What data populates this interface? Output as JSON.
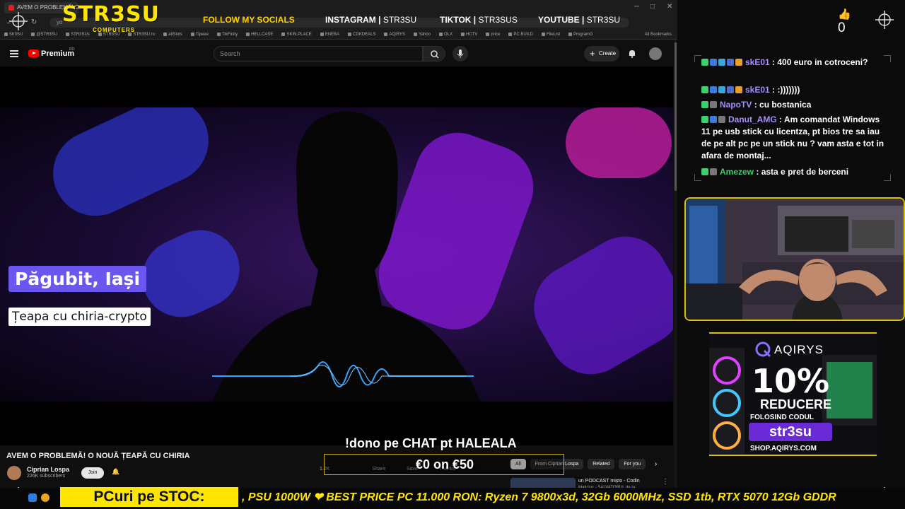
{
  "browser": {
    "tab_title": "AVEM O PROBLEMĂ! O N...",
    "url_text": "yo",
    "bookmarks": [
      "Str3SU",
      "@STR3SU",
      "STR3SUs",
      "STR3SU",
      "STR3SU.ro",
      "altSlots",
      "Tipeee",
      "TikFinity",
      "HELLCASE",
      "SKIN.PLACE",
      "ENEBA",
      "CDKDEALS",
      "AQIRYS",
      "Yahoo",
      "OLX",
      "HCTV",
      "price",
      "PC BUILD",
      "FileList",
      "ProgramG"
    ],
    "all_bookmarks": "All Bookmarks"
  },
  "brand": {
    "logo": "STR3SU",
    "logo_sub": "COMPUTERS",
    "follow": "FOLLOW MY SOCIALS",
    "socials": [
      {
        "platform": "INSTAGRAM",
        "handle": "STR3SU"
      },
      {
        "platform": "TIKTOK",
        "handle": "STR3SUS"
      },
      {
        "platform": "YOUTUBE",
        "handle": "STR3SU"
      }
    ]
  },
  "youtube": {
    "brand": "Premium",
    "region": "RO",
    "search_placeholder": "Search",
    "create_label": "Create"
  },
  "video": {
    "headline": "Păgubit, Iași",
    "subheadline": "Țeapa cu chiria-crypto",
    "title": "AVEM O PROBLEMĂ! O NOUĂ ȚEAPĂ CU CHIRIA",
    "channel": "Ciprian Lospa",
    "subscribers": "226K subscribers",
    "join_label": "Join",
    "actions": [
      "1.2K",
      "",
      "Share",
      "Save",
      "Thanks"
    ]
  },
  "filter_chips": [
    "All",
    "From Ciprian Lospa",
    "Related",
    "For you"
  ],
  "recommendation": {
    "title": "un PODCAST mișto - Codin",
    "channel": "Maticiuc - SALVATORUL de la..."
  },
  "overlay": {
    "dono_command": "!dono pe CHAT pt HALEALA",
    "goal": "€0 on €50",
    "stoc_label": "PCuri pe STOC:",
    "ticker": ", PSU 1000W  ❤ BEST PRICE PC 11.000 RON: Ryzen 7 9800x3d, 32Gb 6000MHz, SSD 1tb, RTX 5070 12Gb GDDR"
  },
  "likes": {
    "count": "0"
  },
  "chat": [
    {
      "user": "skE01",
      "badges": [
        "k",
        "p",
        "cube",
        "2c",
        "1"
      ],
      "text": ": 400 euro in cotroceni?",
      "user_color": "#a98cff"
    },
    {
      "user": "skE01",
      "badges": [
        "k",
        "p",
        "cube",
        "2c",
        "1"
      ],
      "text": ": :)))))))",
      "user_color": "#a98cff"
    },
    {
      "user": "NapoTV",
      "badges": [
        "k",
        "P4"
      ],
      "text": ": cu bostanica",
      "user_color": "#a98cff"
    },
    {
      "user": "Danut_AMG",
      "badges": [
        "k",
        "p",
        "P4"
      ],
      "text": ": Am comandat Windows 11 pe usb stick cu licentza, pt bios tre sa iau de pe alt pc pe un stick nu ? vam asta e tot in afara de montaj...",
      "user_color": "#a98cff"
    },
    {
      "user": "Amezew",
      "badges": [
        "k",
        "P4"
      ],
      "text": ": asta e pret de berceni",
      "user_color": "#3cd070"
    }
  ],
  "ad": {
    "brand": "AQIRYS",
    "percent": "10%",
    "line1": "REDUCERE",
    "line2": "FOLOSIND CODUL",
    "code": "str3su",
    "url": "SHOP.AQIRYS.COM"
  },
  "colors": {
    "accent_yellow": "#ffe600",
    "chat_user": "#a98cff",
    "chat_user_alt": "#3cd070",
    "goal_border": "#c9b100",
    "headline_bg": "#6c56f0"
  }
}
